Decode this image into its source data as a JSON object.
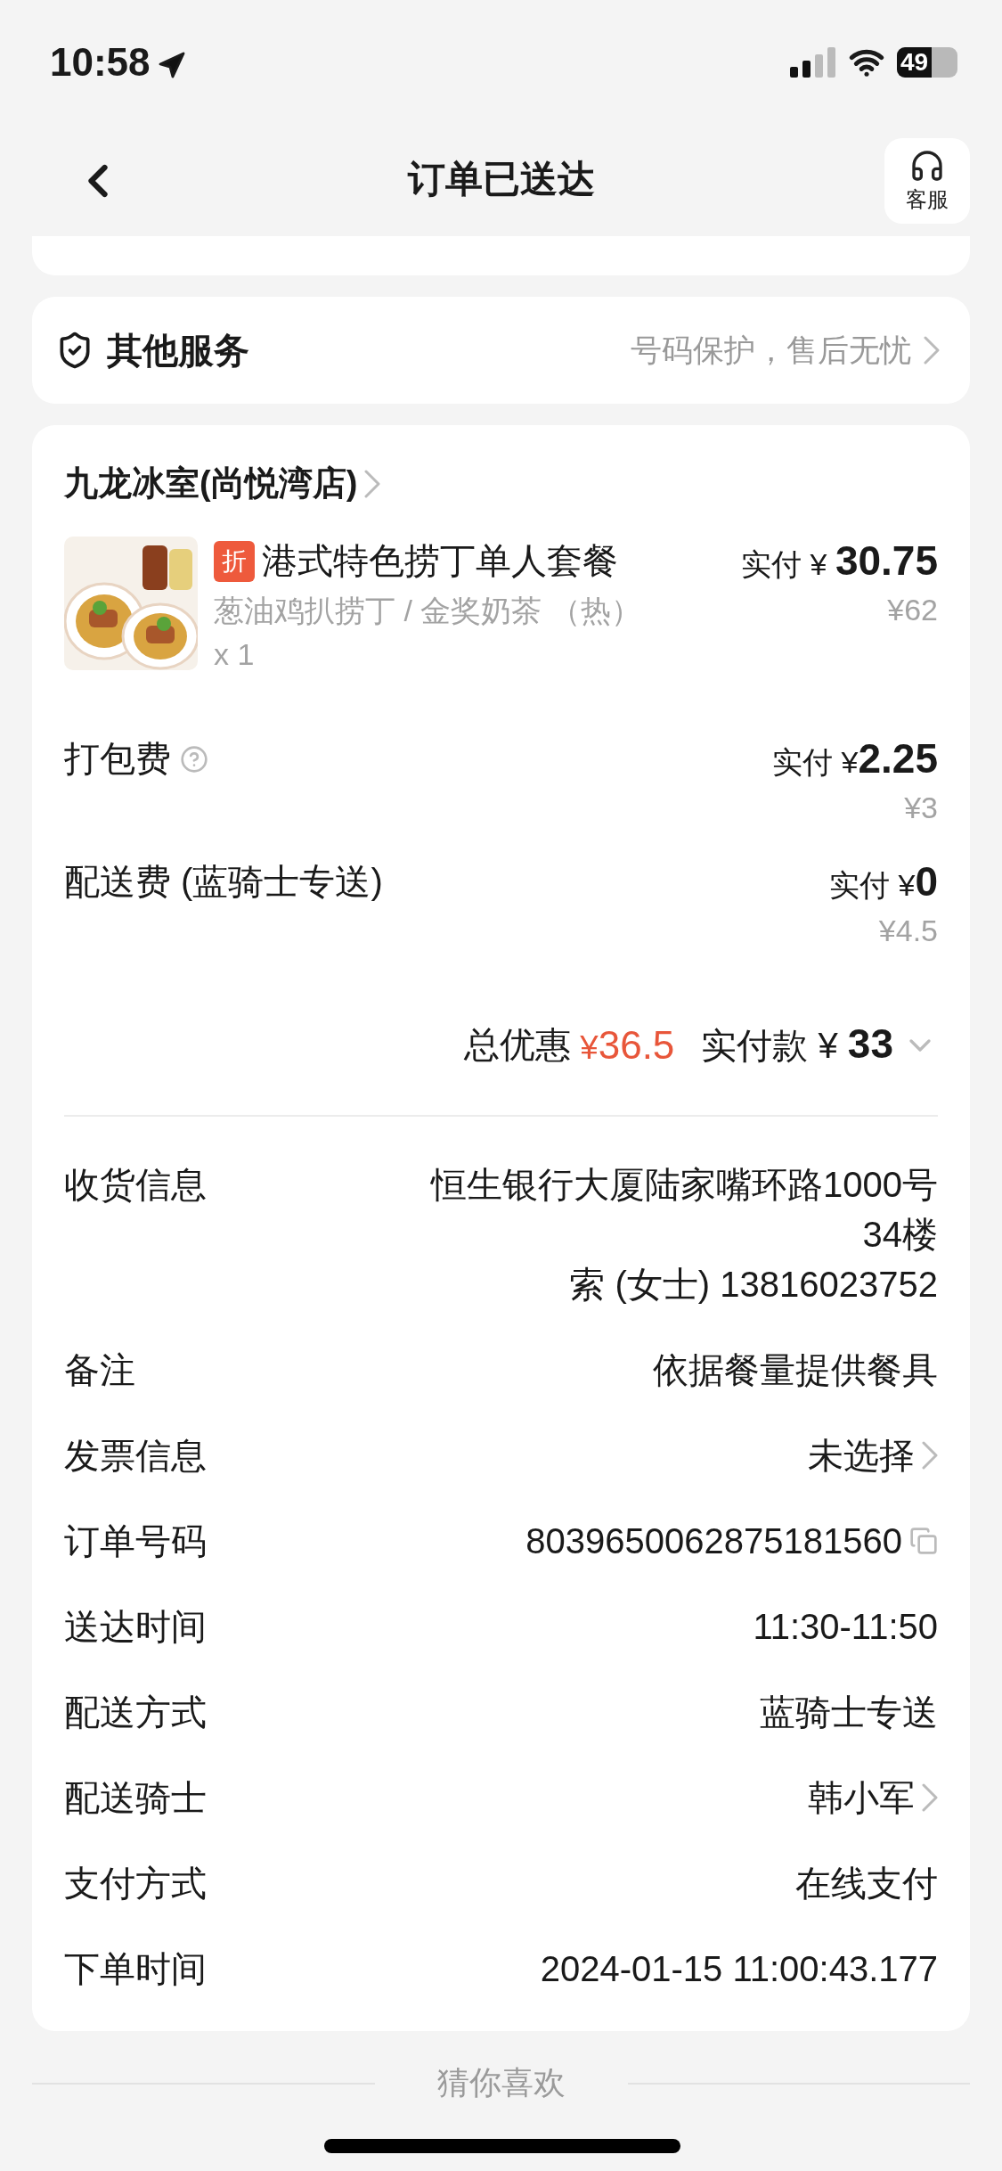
{
  "status_bar": {
    "time": "10:58",
    "battery": "49"
  },
  "nav": {
    "title": "订单已送达",
    "support_label": "客服"
  },
  "services": {
    "title": "其他服务",
    "hint": "号码保护，售后无忧"
  },
  "store": {
    "name": "九龙冰室(尚悦湾店)"
  },
  "items": [
    {
      "tag": "折",
      "name": "港式特色捞丁单人套餐",
      "spec": "葱油鸡扒捞丁 / 金奖奶茶 （热）",
      "quantity": "x 1",
      "paid_label": "实付",
      "currency": "¥",
      "price": "30.75",
      "original": "¥62"
    }
  ],
  "fees": [
    {
      "label": "打包费",
      "help": true,
      "paid_label": "实付",
      "currency": "¥",
      "price": "2.25",
      "original": "¥3"
    },
    {
      "label": "配送费 (蓝骑士专送)",
      "help": false,
      "paid_label": "实付",
      "currency": "¥",
      "price": "0",
      "original": "¥4.5"
    }
  ],
  "total": {
    "discount_label": "总优惠",
    "discount_currency": "¥",
    "discount": "36.5",
    "paid_label": "实付款",
    "currency": "¥",
    "amount": "33",
    "expanded": false
  },
  "info": [
    {
      "label": "收货信息",
      "lines": [
        "恒生银行大厦陆家嘴环路1000号",
        "34楼",
        "索 (女士) 13816023752"
      ],
      "chevron": false,
      "copy": false
    },
    {
      "label": "备注",
      "lines": [
        "依据餐量提供餐具"
      ],
      "chevron": false,
      "copy": false
    },
    {
      "label": "发票信息",
      "lines": [
        "未选择"
      ],
      "chevron": true,
      "copy": false
    },
    {
      "label": "订单号码",
      "lines": [
        "8039650062875181560"
      ],
      "chevron": false,
      "copy": true
    },
    {
      "label": "送达时间",
      "lines": [
        "11:30-11:50"
      ],
      "chevron": false,
      "copy": false
    },
    {
      "label": "配送方式",
      "lines": [
        "蓝骑士专送"
      ],
      "chevron": false,
      "copy": false
    },
    {
      "label": "配送骑士",
      "lines": [
        "韩小军"
      ],
      "chevron": true,
      "copy": false
    },
    {
      "label": "支付方式",
      "lines": [
        "在线支付"
      ],
      "chevron": false,
      "copy": false
    },
    {
      "label": "下单时间",
      "lines": [
        "2024-01-15 11:00:43.177"
      ],
      "chevron": false,
      "copy": false
    }
  ],
  "footer": {
    "title": "猜你喜欢"
  }
}
